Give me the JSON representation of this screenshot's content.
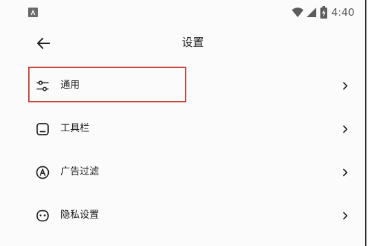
{
  "status_bar": {
    "time": "4:40",
    "icons": [
      "notification-app-icon",
      "wifi-icon",
      "cell-signal-icon",
      "battery-charging-icon"
    ]
  },
  "toolbar": {
    "back_icon": "arrow-left-icon",
    "title": "设置"
  },
  "settings": {
    "items": [
      {
        "label": "通用",
        "icon": "sliders-icon",
        "highlighted": true
      },
      {
        "label": "工具栏",
        "icon": "toolbar-icon",
        "highlighted": false
      },
      {
        "label": "广告过滤",
        "icon": "ad-block-icon",
        "highlighted": false
      },
      {
        "label": "隐私设置",
        "icon": "privacy-mask-icon",
        "highlighted": false
      }
    ],
    "chevron_icon": "chevron-right-icon"
  },
  "colors": {
    "highlight_border": "#c8473d",
    "background": "#fbfbfb",
    "text": "#1b1b1b"
  }
}
